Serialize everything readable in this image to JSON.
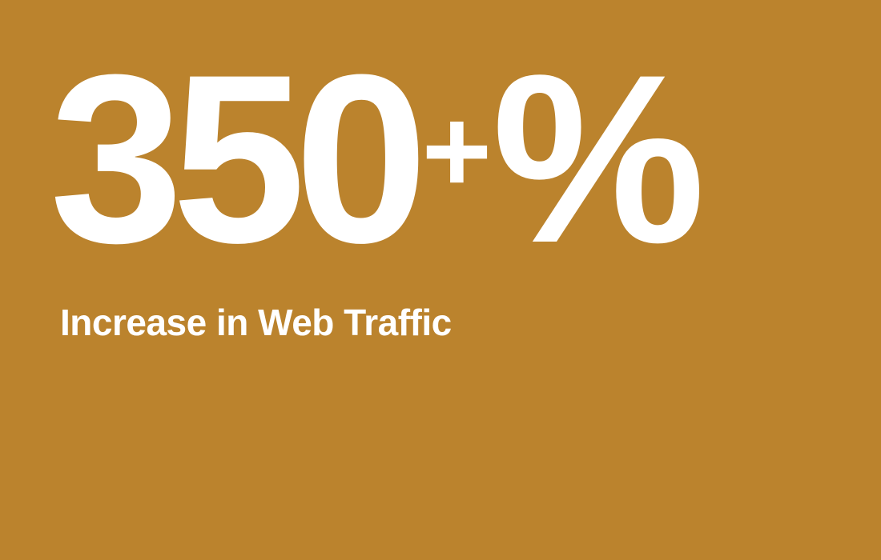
{
  "stat": {
    "number": "350",
    "plus": "+",
    "percent": "%"
  },
  "label": "Increase in Web Traffic",
  "colors": {
    "background": "#BB832D",
    "text": "#FFFFFF"
  }
}
